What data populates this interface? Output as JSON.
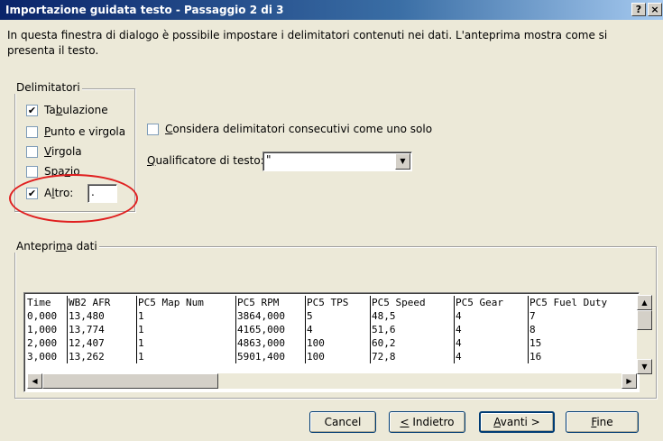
{
  "window": {
    "title": "Importazione guidata testo - Passaggio 2 di 3",
    "help_label": "?",
    "close_label": "×"
  },
  "intro_text": "In questa finestra di dialogo è possibile impostare i delimitatori contenuti nei dati. L'anteprima mostra come si presenta il testo.",
  "delimiters": {
    "legend": "Delimitatori",
    "items": [
      {
        "pre": "Ta",
        "ul": "b",
        "post": "ulazione",
        "checked": true
      },
      {
        "pre": "",
        "ul": "P",
        "post": "unto e virgola",
        "checked": false
      },
      {
        "pre": "",
        "ul": "V",
        "post": "irgola",
        "checked": false
      },
      {
        "pre": "Spa",
        "ul": "z",
        "post": "io",
        "checked": false
      },
      {
        "pre": "A",
        "ul": "l",
        "post": "tro:",
        "checked": true
      }
    ],
    "other_value": "."
  },
  "options": {
    "consecutive": {
      "pre": "",
      "ul": "C",
      "post": "onsidera delimitatori consecutivi come uno solo",
      "checked": false
    },
    "qualifier_label": {
      "pre": "",
      "ul": "Q",
      "post": "ualificatore di testo:"
    },
    "qualifier_value": "\""
  },
  "preview": {
    "legend": {
      "pre": "Antepri",
      "ul": "m",
      "post": "a dati"
    },
    "columns": [
      "Time",
      "WB2 AFR",
      "PC5 Map Num",
      "PC5 RPM",
      "PC5 TPS",
      "PC5 Speed",
      "PC5 Gear",
      "PC5 Fuel Duty"
    ],
    "rows": [
      [
        "0,000",
        "13,480",
        "1",
        "3864,000",
        "5",
        "48,5",
        "4",
        "7"
      ],
      [
        "1,000",
        "13,774",
        "1",
        "4165,000",
        "4",
        "51,6",
        "4",
        "8"
      ],
      [
        "2,000",
        "12,407",
        "1",
        "4863,000",
        "100",
        "60,2",
        "4",
        "15"
      ],
      [
        "3,000",
        "13,262",
        "1",
        "5901,400",
        "100",
        "72,8",
        "4",
        "16"
      ]
    ]
  },
  "buttons": {
    "cancel": "Cancel",
    "back": {
      "pre": "",
      "ul": "<",
      "post": " Indietro"
    },
    "next": {
      "pre": "",
      "ul": "A",
      "post": "vanti >"
    },
    "finish": {
      "pre": "",
      "ul": "F",
      "post": "ine"
    }
  }
}
